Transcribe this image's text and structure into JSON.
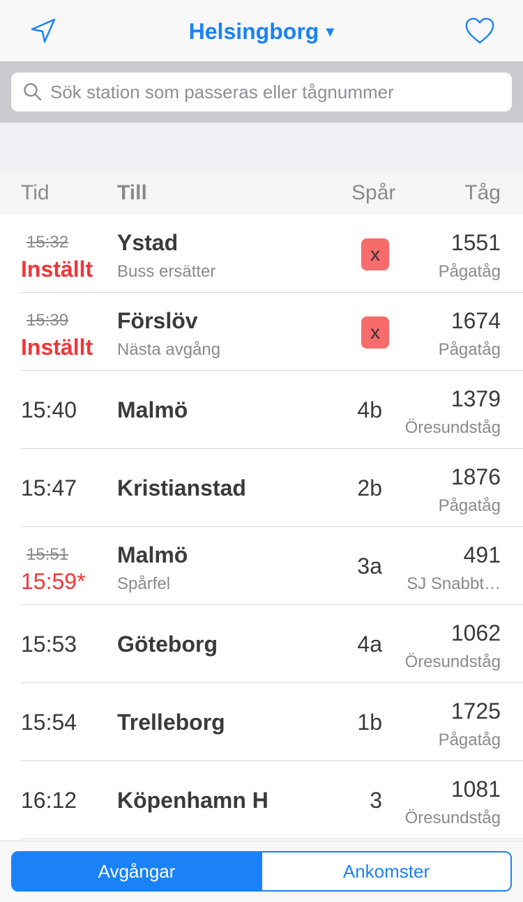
{
  "header": {
    "title": "Helsingborg",
    "caret": "▾",
    "left_icon": "location-arrow-icon",
    "right_icon": "heart-icon",
    "accent_color": "#1a82f6"
  },
  "search": {
    "placeholder": "Sök station som passeras eller tågnummer",
    "value": ""
  },
  "columns": {
    "time": "Tid",
    "to": "Till",
    "track": "Spår",
    "train": "Tåg"
  },
  "departures": [
    {
      "time_original": "15:32",
      "status": "Inställt",
      "destination": "Ystad",
      "note": "Buss ersätter",
      "track": "x",
      "train_no": "1551",
      "operator": "Pågatåg"
    },
    {
      "time_original": "15:39",
      "status": "Inställt",
      "destination": "Förslöv",
      "note": "Nästa avgång",
      "track": "x",
      "train_no": "1674",
      "operator": "Pågatåg"
    },
    {
      "time": "15:40",
      "destination": "Malmö",
      "track": "4b",
      "train_no": "1379",
      "operator": "Öresundståg"
    },
    {
      "time": "15:47",
      "destination": "Kristianstad",
      "track": "2b",
      "train_no": "1876",
      "operator": "Pågatåg"
    },
    {
      "time_original": "15:51",
      "time_new": "15:59*",
      "destination": "Malmö",
      "note": "Spårfel",
      "track": "3a",
      "train_no": "491",
      "operator": "SJ Snabbt…"
    },
    {
      "time": "15:53",
      "destination": "Göteborg",
      "track": "4a",
      "train_no": "1062",
      "operator": "Öresundståg"
    },
    {
      "time": "15:54",
      "destination": "Trelleborg",
      "track": "1b",
      "train_no": "1725",
      "operator": "Pågatåg"
    },
    {
      "time": "16:12",
      "destination": "Köpenhamn H",
      "track": "3",
      "train_no": "1081",
      "operator": "Öresundståg"
    }
  ],
  "tabs": {
    "departures": "Avgångar",
    "arrivals": "Ankomster",
    "selected": "departures"
  },
  "colors": {
    "cancelled_red": "#f2353a",
    "cancelled_badge": "#f86b6b"
  }
}
